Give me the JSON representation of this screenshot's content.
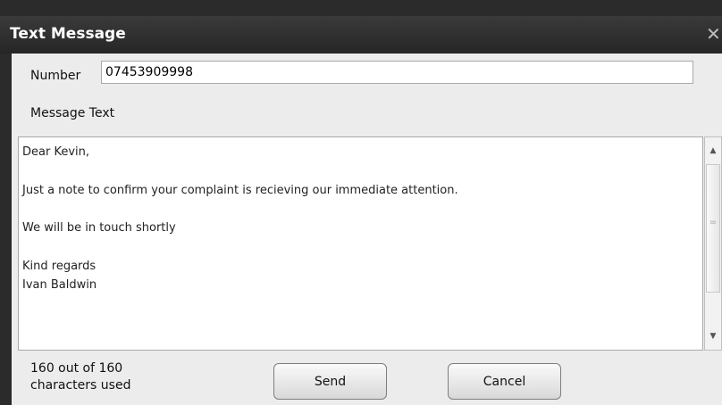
{
  "window": {
    "title": "Text Message",
    "close_glyph": "✕"
  },
  "form": {
    "number_label": "Number",
    "number_value": "07453909998",
    "message_label": "Message Text",
    "message_text": "Dear Kevin,\n\nJust a note to confirm your complaint is recieving our immediate attention.\n\nWe will be in touch shortly\n\nKind regards\nIvan Baldwin",
    "counter_line1": "160 out of 160",
    "counter_line2": "characters used"
  },
  "scrollbar": {
    "up_glyph": "▲",
    "down_glyph": "▼",
    "grip_glyph": "="
  },
  "buttons": {
    "send_label": "Send",
    "cancel_label": "Cancel"
  },
  "icons": {
    "close": "close-icon",
    "scroll_up": "scroll-up-icon",
    "scroll_down": "scroll-down-icon"
  }
}
